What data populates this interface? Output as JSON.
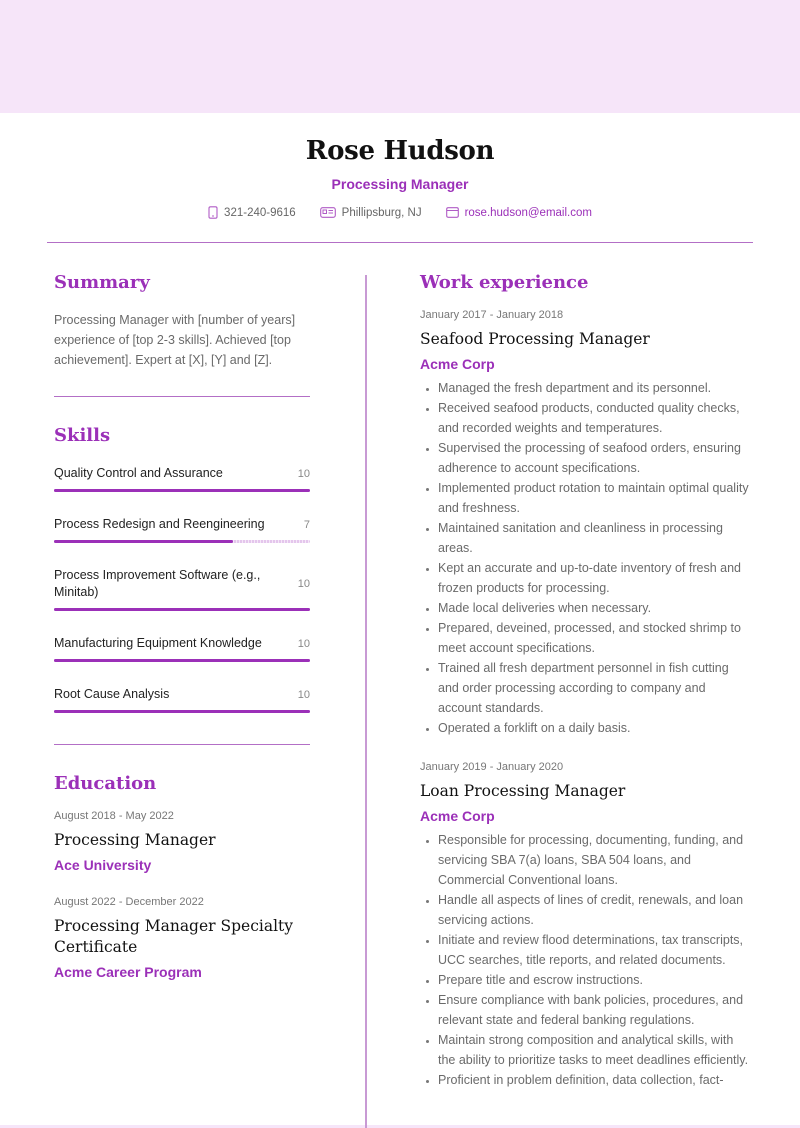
{
  "header": {
    "name": "Rose Hudson",
    "title": "Processing Manager",
    "contacts": {
      "phone": "321-240-9616",
      "location": "Phillipsburg, NJ",
      "email": "rose.hudson@email.com"
    },
    "icons": {
      "phone": "phone-icon",
      "location": "map-card-icon",
      "email": "envelope-icon"
    }
  },
  "colors": {
    "accent": "#9b30b8",
    "band": "#f6e5f9",
    "rule": "#b36fc6"
  },
  "summary": {
    "heading": "Summary",
    "text": "Processing Manager with [number of years] experience of [top 2-3 skills]. Achieved [top achievement]. Expert at [X], [Y] and [Z]."
  },
  "skills": {
    "heading": "Skills",
    "max": 10,
    "items": [
      {
        "name": "Quality Control and Assurance",
        "value": 10
      },
      {
        "name": "Process Redesign and Reengineering",
        "value": 7
      },
      {
        "name": "Process Improvement Software (e.g., Minitab)",
        "value": 10
      },
      {
        "name": "Manufacturing Equipment Knowledge",
        "value": 10
      },
      {
        "name": "Root Cause Analysis",
        "value": 10
      }
    ]
  },
  "education": {
    "heading": "Education",
    "items": [
      {
        "dates": "August 2018 - May 2022",
        "degree": "Processing Manager",
        "school": "Ace University"
      },
      {
        "dates": "August 2022 - December 2022",
        "degree": "Processing Manager Specialty Certificate",
        "school": "Acme Career Program"
      }
    ]
  },
  "work": {
    "heading": "Work experience",
    "jobs": [
      {
        "dates": "January 2017 - January 2018",
        "role": "Seafood Processing Manager",
        "company": "Acme Corp",
        "bullets": [
          "Managed the fresh department and its personnel.",
          "Received seafood products, conducted quality checks, and recorded weights and temperatures.",
          "Supervised the processing of seafood orders, ensuring adherence to account specifications.",
          "Implemented product rotation to maintain optimal quality and freshness.",
          "Maintained sanitation and cleanliness in processing areas.",
          "Kept an accurate and up-to-date inventory of fresh and frozen products for processing.",
          "Made local deliveries when necessary.",
          "Prepared, deveined, processed, and stocked shrimp to meet account specifications.",
          "Trained all fresh department personnel in fish cutting and order processing according to company and account standards.",
          "Operated a forklift on a daily basis."
        ]
      },
      {
        "dates": "January 2019 - January 2020",
        "role": "Loan Processing Manager",
        "company": "Acme Corp",
        "bullets": [
          "Responsible for processing, documenting, funding, and servicing SBA 7(a) loans, SBA 504 loans, and Commercial Conventional loans.",
          "Handle all aspects of lines of credit, renewals, and loan servicing actions.",
          "Initiate and review flood determinations, tax transcripts, UCC searches, title reports, and related documents.",
          "Prepare title and escrow instructions.",
          "Ensure compliance with bank policies, procedures, and relevant state and federal banking regulations.",
          "Maintain strong composition and analytical skills, with the ability to prioritize tasks to meet deadlines efficiently.",
          "Proficient in problem definition, data collection, fact-"
        ]
      }
    ]
  }
}
